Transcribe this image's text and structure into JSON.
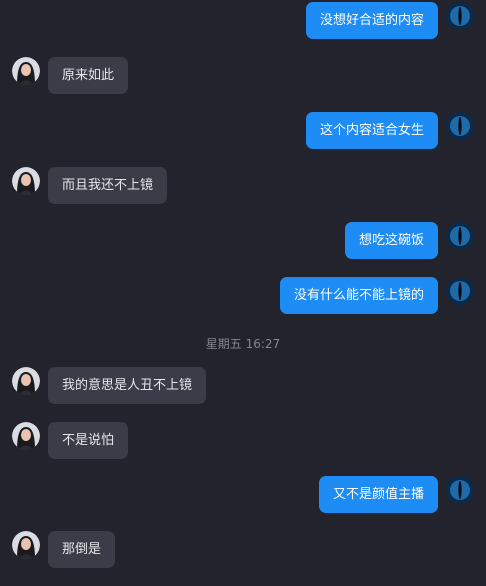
{
  "messages": [
    {
      "side": "out",
      "text": "没想好合适的内容"
    },
    {
      "side": "in",
      "text": "原来如此"
    },
    {
      "side": "out",
      "text": "这个内容适合女生"
    },
    {
      "side": "in",
      "text": "而且我还不上镜"
    },
    {
      "side": "out",
      "text": "想吃这碗饭"
    },
    {
      "side": "out",
      "text": "没有什么能不能上镜的"
    },
    {
      "side": "in",
      "text": "我的意思是人丑不上镜"
    },
    {
      "side": "in",
      "text": "不是说怕"
    },
    {
      "side": "out",
      "text": "又不是颜值主播"
    },
    {
      "side": "in",
      "text": "那倒是"
    }
  ],
  "timestamp": "星期五 16:27",
  "colors": {
    "background": "#23232d",
    "incoming_bubble": "#3c3c48",
    "outgoing_bubble": "#1d8cf5"
  },
  "icons": {
    "contact_avatar": "woman-portrait-avatar-icon",
    "self_avatar": "blue-eye-avatar-icon"
  }
}
